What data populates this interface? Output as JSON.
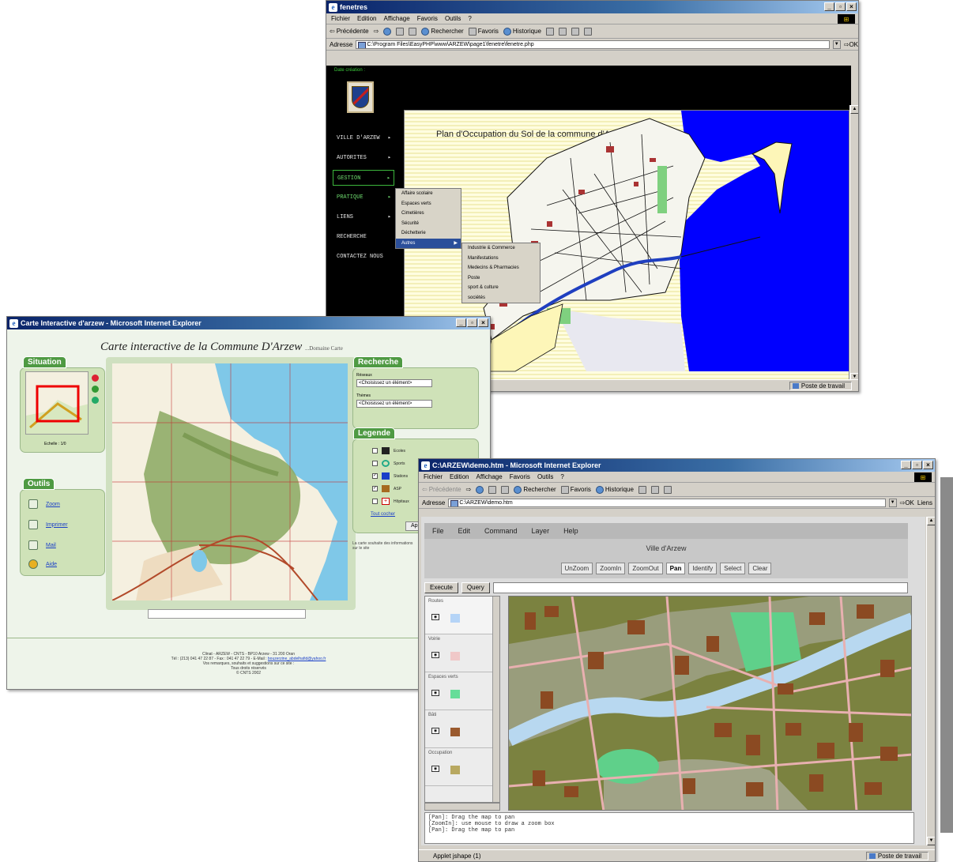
{
  "w1": {
    "title": "fenetres",
    "menu": [
      "Fichier",
      "Edition",
      "Affichage",
      "Favoris",
      "Outils",
      "?"
    ],
    "toolbar": {
      "back": "Précédente",
      "search": "Rechercher",
      "favorites": "Favoris",
      "history": "Historique"
    },
    "address_label": "Adresse",
    "address": "C:\\Program Files\\EasyPHP\\www\\ARZEW\\page1\\fenetre\\fenetre.php",
    "go": "OK",
    "date_label": "Date création :",
    "nav": [
      {
        "label": "VILLE D'ARZEW"
      },
      {
        "label": "AUTORITES"
      },
      {
        "label": "GESTION"
      },
      {
        "label": "PRATIQUE"
      },
      {
        "label": "LIENS"
      },
      {
        "label": "RECHERCHE"
      },
      {
        "label": "CONTACTEZ NOUS"
      }
    ],
    "submenu1": [
      "Affaire scolaire",
      "Espaces verts",
      "Cimetières",
      "Sécurité",
      "Déchetterie",
      "Autres"
    ],
    "submenu2": [
      "Industrie & Commerce",
      "Manifestations",
      "Medecins & Pharmacies",
      "Poste",
      "sport & culture",
      "sociétés"
    ],
    "map_title": "Plan d'Occupation du Sol de la commune d'Arzew",
    "status": "Poste de travail",
    "colors": {
      "sea": "#0000ff",
      "land": "#fdf6b8",
      "roads": "#111111",
      "river": "#1f3fc0"
    }
  },
  "w2": {
    "title": "Carte Interactive d'arzew - Microsoft Internet Explorer",
    "header": "Carte interactive de la Commune D'Arzew",
    "header_small": "...Domaine Carte",
    "situation_tab": "Situation",
    "scale": "Echelle : 1/0",
    "outils_tab": "Outils",
    "outils": [
      "Zoom",
      "Imprimer",
      "Mail",
      "Aide"
    ],
    "recherche_tab": "Recherche",
    "reseaux_label": "Réseaux",
    "themes_label": "Thèmes",
    "select_placeholder": "<Choisissez un élément>",
    "legende_tab": "Legende",
    "legend": [
      {
        "label": "Ecoles",
        "checked": false
      },
      {
        "label": "Sports",
        "checked": false
      },
      {
        "label": "Stations",
        "checked": true
      },
      {
        "label": "ASP",
        "checked": true
      },
      {
        "label": "Hôpitaux",
        "checked": false
      }
    ],
    "tout_cocher": "Tout cocher",
    "apply": "Appl",
    "note": "La carte souhaite des informations sur le site",
    "footer": [
      "Clinat - ARZEW - CNTS - BP10 Arzew - 31 200 Oran",
      "Tél : (213) 041 47 22 87 - Fax : 041 47 22 79 - E-Mail : ",
      "Vos remarques, souhaits et suggestions sur ce site : ",
      "Tous droits réservés",
      "© CNTS 2002"
    ],
    "footer_email": "bouzerzine_abdelhafid@yahoo.fr"
  },
  "w3": {
    "title": "C:\\ARZEW\\demo.htm - Microsoft Internet Explorer",
    "menu": [
      "Fichier",
      "Edition",
      "Affichage",
      "Favoris",
      "Outils",
      "?"
    ],
    "toolbar": {
      "back": "Précédente",
      "search": "Rechercher",
      "favorites": "Favoris",
      "history": "Historique"
    },
    "address_label": "Adresse",
    "address": "C:\\ARZEW\\demo.htm",
    "go": "OK",
    "links": "Liens",
    "app_menu": [
      "File",
      "Edit",
      "Command",
      "Layer",
      "Help"
    ],
    "app_title": "Ville d'Arzew",
    "tools": [
      "UnZoom",
      "ZoomIn",
      "ZoomOut",
      "Pan",
      "Identify",
      "Select",
      "Clear"
    ],
    "active_tool": "Pan",
    "execute": "Execute",
    "query": "Query",
    "layers": [
      {
        "name": "Routes",
        "color": "#b5d4f7"
      },
      {
        "name": "Voirie",
        "color": "#f0c8c8"
      },
      {
        "name": "Espaces verts",
        "color": "#66dd99"
      },
      {
        "name": "Bâti",
        "color": "#9a5a2e"
      },
      {
        "name": "Occupation",
        "color": "#b8a860"
      }
    ],
    "console": [
      "[Pan]: Drag the map to pan",
      "[ZoomIn]: use mouse to draw a zoom box",
      "[Pan]: Drag the map to pan"
    ],
    "status_left": "Applet jshape (1)",
    "status_right": "Poste de travail",
    "colors": {
      "ground": "#7b8240",
      "roads": "#e8b0b0",
      "water": "#b8d8f0",
      "green": "#5fd08a",
      "buildings": "#8b4a22"
    }
  }
}
